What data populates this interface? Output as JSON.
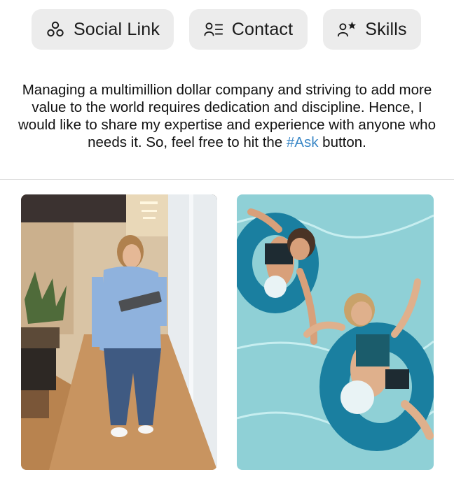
{
  "tabs": [
    {
      "label": "Social Link",
      "icon": "social-link-icon"
    },
    {
      "label": "Contact",
      "icon": "contact-list-icon"
    },
    {
      "label": "Skills",
      "icon": "user-star-icon"
    }
  ],
  "bio": {
    "text": "Managing a multimillion dollar company and striving to add more value to the world requires dedication and discipline. Hence, I would like to share my expertise and experience with anyone who needs it. So, feel free to hit the ",
    "link": "#Ask",
    "suffix": " button."
  },
  "photos": [
    {
      "subject": "woman-walking-office-hallway"
    },
    {
      "subject": "two-women-floating-pool-tubes"
    }
  ],
  "colors": {
    "tab_bg": "#ececec",
    "link": "#3a87c6",
    "divider": "#dcdcdc",
    "pool": "#8fd0d6"
  }
}
